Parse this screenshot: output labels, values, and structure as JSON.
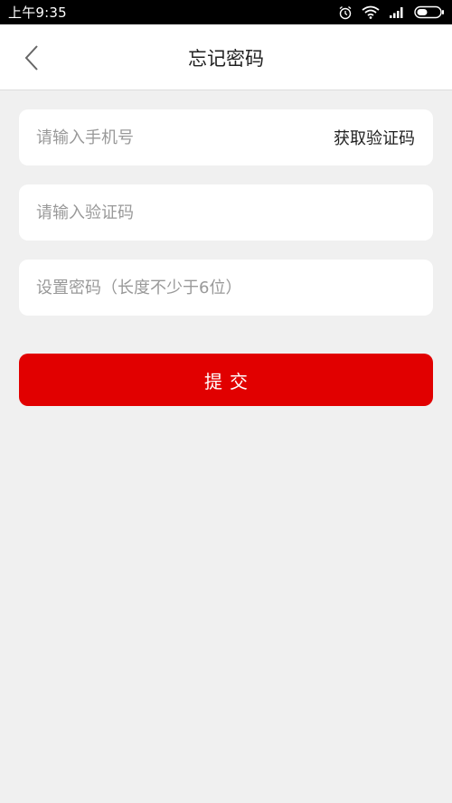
{
  "status_bar": {
    "time": "上午9:35",
    "icons": [
      "alarm-icon",
      "wifi-icon",
      "signal-icon",
      "battery-icon"
    ]
  },
  "header": {
    "title": "忘记密码",
    "back_icon": "chevron-left-icon"
  },
  "form": {
    "phone": {
      "placeholder": "请输入手机号",
      "value": ""
    },
    "get_code_label": "获取验证码",
    "code": {
      "placeholder": "请输入验证码",
      "value": ""
    },
    "password": {
      "placeholder": "设置密码（长度不少于6位）",
      "value": ""
    },
    "submit_label": "提交"
  },
  "colors": {
    "accent": "#e10000",
    "background": "#f0f0f0",
    "status_bar": "#000000"
  }
}
